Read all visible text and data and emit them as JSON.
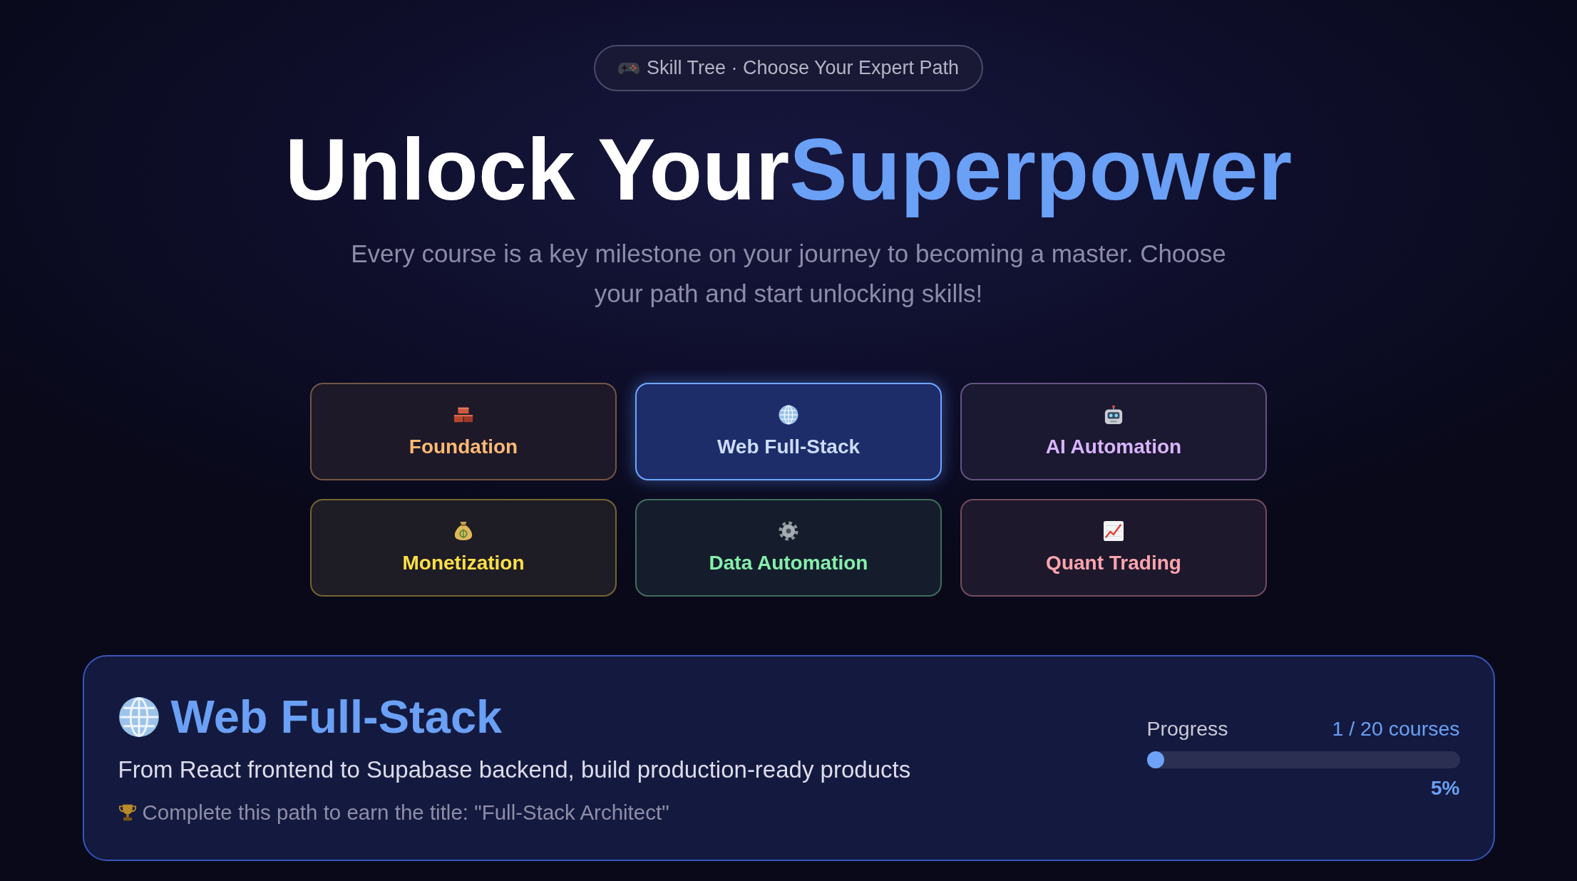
{
  "badge": {
    "text": "Skill Tree · Choose Your Expert Path"
  },
  "hero": {
    "title_lead": "Unlock Your",
    "title_highlight": "Superpower",
    "subtitle": "Every course is a key milestone on your journey to becoming a master. Choose your path and start unlocking skills!"
  },
  "paths": [
    {
      "label": "Foundation",
      "color": "#fdba74",
      "selected": false
    },
    {
      "label": "Web Full-Stack",
      "color": "#cddcfa",
      "selected": true
    },
    {
      "label": "AI Automation",
      "color": "#d8b4fe",
      "selected": false
    },
    {
      "label": "Monetization",
      "color": "#fde047",
      "selected": false
    },
    {
      "label": "Data Automation",
      "color": "#86efac",
      "selected": false
    },
    {
      "label": "Quant Trading",
      "color": "#fda4af",
      "selected": false
    }
  ],
  "detail": {
    "title": "Web Full-Stack",
    "description": "From React frontend to Supabase backend, build production-ready products",
    "achievement": "Complete this path to earn the title: \"Full-Stack Architect\"",
    "progress": {
      "label": "Progress",
      "count": "1 / 20 courses",
      "level": 0.05,
      "percent": "5%"
    }
  }
}
